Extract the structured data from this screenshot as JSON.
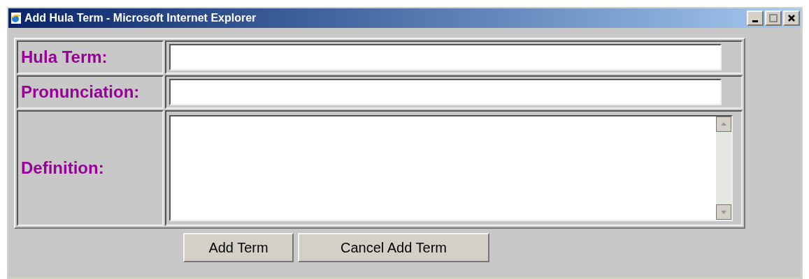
{
  "window": {
    "title": "Add Hula Term - Microsoft Internet Explorer"
  },
  "form": {
    "rows": [
      {
        "label": "Hula Term:",
        "kind": "text"
      },
      {
        "label": "Pronunciation:",
        "kind": "text"
      },
      {
        "label": "Definition:",
        "kind": "textarea"
      }
    ]
  },
  "buttons": [
    "Add Term",
    "Cancel Add Term"
  ]
}
